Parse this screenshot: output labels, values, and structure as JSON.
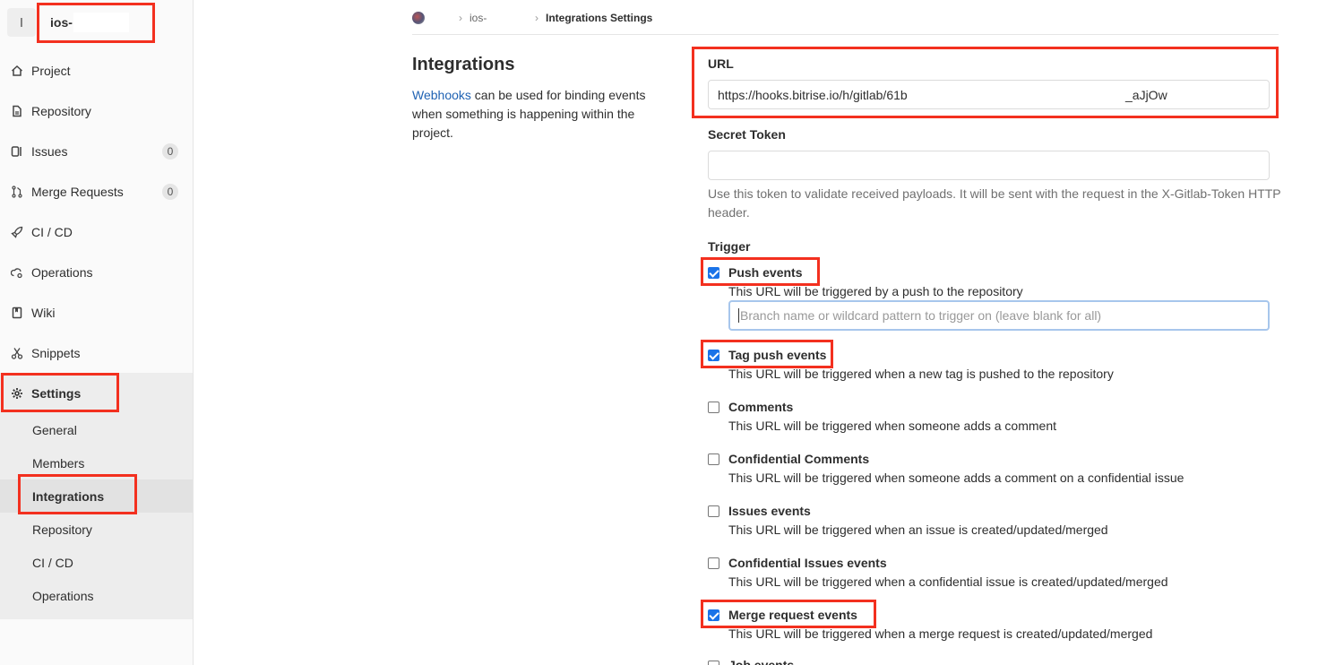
{
  "project": {
    "avatar_letter": "I",
    "name": "ios-"
  },
  "sidebar": {
    "items": [
      {
        "label": "Project"
      },
      {
        "label": "Repository"
      },
      {
        "label": "Issues",
        "badge": "0"
      },
      {
        "label": "Merge Requests",
        "badge": "0"
      },
      {
        "label": "CI / CD"
      },
      {
        "label": "Operations"
      },
      {
        "label": "Wiki"
      },
      {
        "label": "Snippets"
      },
      {
        "label": "Settings"
      }
    ],
    "settings_sub": [
      {
        "label": "General"
      },
      {
        "label": "Members"
      },
      {
        "label": "Integrations"
      },
      {
        "label": "Repository"
      },
      {
        "label": "CI / CD"
      },
      {
        "label": "Operations"
      }
    ]
  },
  "breadcrumb": {
    "project": "ios-",
    "current": "Integrations Settings"
  },
  "page": {
    "title": "Integrations",
    "desc_link": "Webhooks",
    "desc_text": " can be used for binding events when something is happening within the project."
  },
  "form": {
    "url_label": "URL",
    "url_value": "https://hooks.bitrise.io/h/gitlab/61b",
    "url_tail": "_aJjOw",
    "secret_label": "Secret Token",
    "secret_value": "",
    "secret_help": "Use this token to validate received payloads. It will be sent with the request in the X-Gitlab-Token HTTP header.",
    "trigger_label": "Trigger",
    "branch_placeholder": "Branch name or wildcard pattern to trigger on (leave blank for all)"
  },
  "events": [
    {
      "title": "Push events",
      "desc": "This URL will be triggered by a push to the repository",
      "checked": true
    },
    {
      "title": "Tag push events",
      "desc": "This URL will be triggered when a new tag is pushed to the repository",
      "checked": true
    },
    {
      "title": "Comments",
      "desc": "This URL will be triggered when someone adds a comment",
      "checked": false
    },
    {
      "title": "Confidential Comments",
      "desc": "This URL will be triggered when someone adds a comment on a confidential issue",
      "checked": false
    },
    {
      "title": "Issues events",
      "desc": "This URL will be triggered when an issue is created/updated/merged",
      "checked": false
    },
    {
      "title": "Confidential Issues events",
      "desc": "This URL will be triggered when a confidential issue is created/updated/merged",
      "checked": false
    },
    {
      "title": "Merge request events",
      "desc": "This URL will be triggered when a merge request is created/updated/merged",
      "checked": true
    },
    {
      "title": "Job events",
      "desc": "",
      "checked": false
    }
  ],
  "colors": {
    "annotation": "#f3301f",
    "link": "#1f62b3",
    "checkbox": "#1a73e8"
  }
}
